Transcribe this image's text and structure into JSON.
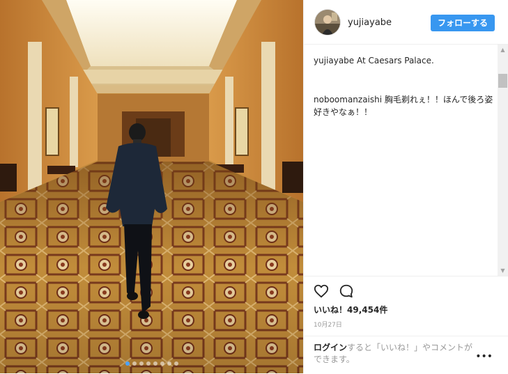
{
  "post": {
    "username": "yujiayabe",
    "follow_label": "フォローする",
    "caption": {
      "user": "yujiayabe",
      "text": "At Caesars Palace."
    },
    "comments": [
      {
        "user": "noboomanzaishi",
        "text": "胸毛剃れぇ！！ほんで後ろ姿好きやなぁ！！"
      }
    ],
    "likes_label": "いいね！",
    "likes_count": "49,454件",
    "date": "10月27日",
    "login_link": "ログイン",
    "login_suffix": "すると「いいね！」やコメントができます。",
    "carousel": {
      "count": 8,
      "active_index": 0
    }
  },
  "icons": {
    "like": "heart-icon",
    "comment": "comment-bubble-icon",
    "more": "more-options-icon",
    "avatar": "avatar"
  },
  "colors": {
    "follow_button": "#3897f0",
    "carpet": "#c28a3c",
    "wall": "#d28f3f",
    "ceiling": "#f3ead5"
  }
}
